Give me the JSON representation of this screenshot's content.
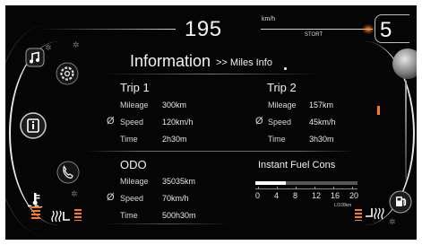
{
  "header": {
    "speed": "195",
    "speed_unit": "km/h",
    "engine_state": "STORT",
    "gear": "5"
  },
  "page": {
    "title": "Information",
    "breadcrumb": ">> Miles Info"
  },
  "trip1": {
    "title": "Trip 1",
    "mileage_label": "Mileage",
    "mileage": "300km",
    "speed_label": "Speed",
    "speed": "120km/h",
    "time_label": "Time",
    "time": "2h30m"
  },
  "trip2": {
    "title": "Trip 2",
    "mileage_label": "Mileage",
    "mileage": "157km",
    "speed_label": "Speed",
    "speed": "45km/h",
    "time_label": "Time",
    "time": "3h30m"
  },
  "odo": {
    "title": "ODO",
    "mileage_label": "Mileage",
    "mileage": "35035km",
    "speed_label": "Speed",
    "speed": "70km/h",
    "time_label": "Time",
    "time": "500h30m"
  },
  "fuel": {
    "title": "Instant Fuel Cons",
    "ticks": [
      "0",
      "4",
      "8",
      "12",
      "16",
      "20"
    ],
    "unit": "L/100km",
    "level": 0.3
  },
  "icons": {
    "left": [
      "music-icon",
      "settings-icon",
      "info-icon",
      "phone-icon",
      "coolant-temp-icon",
      "seat-heater-icon"
    ],
    "right": [
      "fuel-pump-icon",
      "seat-heater-icon"
    ]
  },
  "colors": {
    "accent": "#ff7a1a",
    "background": "#050505",
    "text": "#ffffff"
  }
}
